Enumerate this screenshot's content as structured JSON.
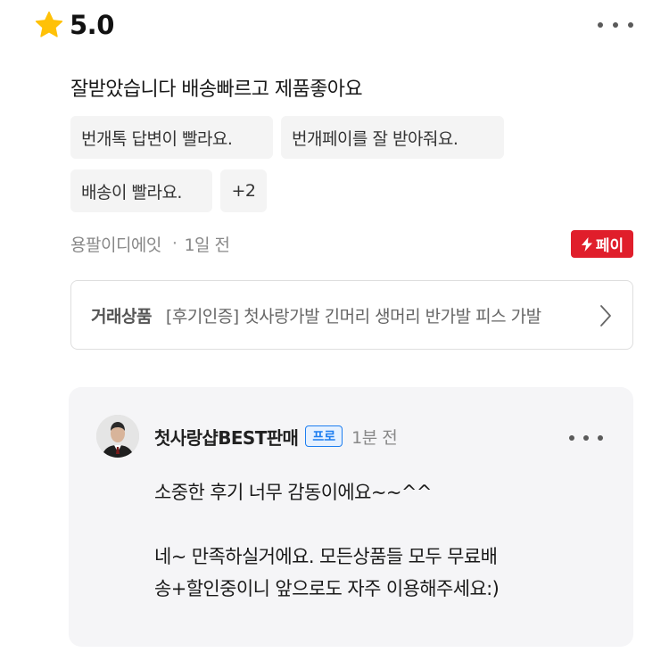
{
  "review": {
    "rating": "5.0",
    "text": "잘받았습니다 배송빠르고 제품좋아요",
    "tags": [
      "번개톡 답변이 빨라요.",
      "번개페이를 잘 받아줘요.",
      "배송이 빨라요.",
      "+2"
    ],
    "reviewer": "용팔이디에잇",
    "time": "1일 전",
    "pay_badge": "페이",
    "product_label": "거래상품",
    "product_title": "[후기인증] 첫사랑가발 긴머리 생머리 반가발 피스 가발"
  },
  "reply": {
    "seller_name": "첫사랑샵BEST판매",
    "badge": "프로",
    "time": "1분 전",
    "line1": "소중한 후기 너무 감동이에요~~^^",
    "line2": "네~ 만족하실거에요. 모든상품들 모두 무료배",
    "line3": "송+할인중이니 앞으로도 자주 이용해주세요:)"
  },
  "colors": {
    "star": "#FFC107",
    "pay_red": "#E01E2B",
    "pro_blue": "#1D7EF0",
    "reply_bg": "#F5F5F7",
    "tag_bg": "#F4F4F4"
  },
  "icons": [
    "star-icon",
    "more-icon",
    "lightning-icon",
    "chevron-right-icon",
    "avatar"
  ]
}
